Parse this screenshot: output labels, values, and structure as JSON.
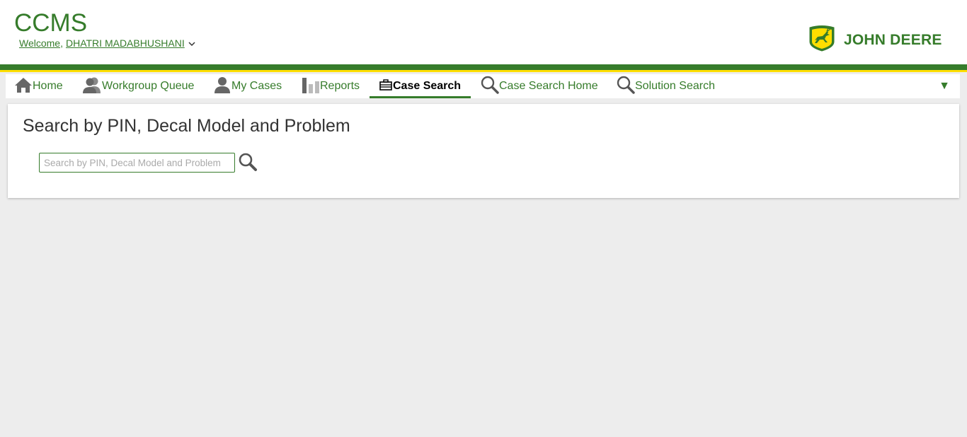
{
  "header": {
    "app_title": "CCMS",
    "welcome_label": "Welcome,",
    "user_name": "DHATRI MADABHUSHANI",
    "brand": "JOHN DEERE",
    "brand_colors": {
      "green": "#367c2b",
      "yellow": "#ffde00"
    }
  },
  "nav": {
    "items": [
      {
        "label": "Home",
        "icon": "home-icon"
      },
      {
        "label": "Workgroup Queue",
        "icon": "group-icon"
      },
      {
        "label": "My Cases",
        "icon": "user-icon"
      },
      {
        "label": "Reports",
        "icon": "bar-chart-icon"
      },
      {
        "label": "Case Search",
        "icon": "briefcase-icon",
        "active": true
      },
      {
        "label": "Case Search Home",
        "icon": "search-icon"
      },
      {
        "label": "Solution Search",
        "icon": "search-icon"
      }
    ],
    "more_glyph": "▼"
  },
  "main": {
    "title": "Search by PIN, Decal Model and Problem",
    "search": {
      "placeholder": "Search by PIN, Decal Model and Problem",
      "value": ""
    }
  }
}
